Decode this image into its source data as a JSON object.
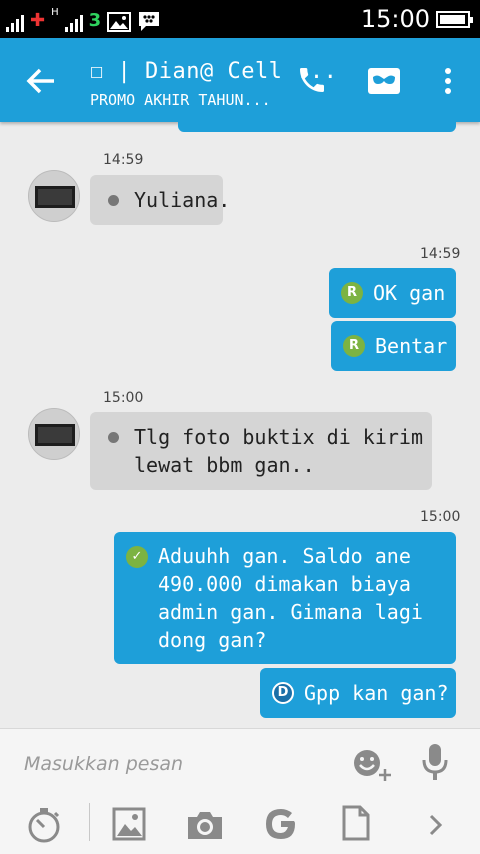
{
  "status_bar": {
    "time": "15:00",
    "network_label": "H",
    "carrier_glyph": "3",
    "battery_level": 0.95
  },
  "header": {
    "title": "☐ | Dian@ Cell ...",
    "subtitle": "PROMO AKHIR TAHUN...",
    "icons": [
      "back-arrow-icon",
      "phone-icon",
      "mask-icon",
      "more-vert-icon"
    ]
  },
  "messages": [
    {
      "time": "14:59",
      "direction": "in",
      "text": "Yuliana.",
      "indicator": "dot"
    },
    {
      "time": "14:59",
      "direction": "out",
      "text": "OK gan",
      "indicator": "R"
    },
    {
      "time": "",
      "direction": "out",
      "text": "Bentar",
      "indicator": "R"
    },
    {
      "time": "15:00",
      "direction": "in",
      "text_lines": [
        "Tlg foto buktix di kirim",
        "lewat bbm gan.."
      ],
      "indicator": "dot"
    },
    {
      "time": "15:00",
      "direction": "out",
      "text_lines": [
        "Aduuhh gan. Saldo ane",
        "490.000 dimakan biaya",
        "admin gan. Gimana lagi",
        "dong gan?"
      ],
      "indicator": "check"
    },
    {
      "time": "",
      "direction": "out",
      "text": "Gpp kan gan?",
      "indicator": "D"
    }
  ],
  "indicators": {
    "read": "R",
    "delivered": "D",
    "check": "✓"
  },
  "composer": {
    "placeholder": "Masukkan pesan",
    "icons": [
      "emoji-add-icon",
      "microphone-icon",
      "timer-icon",
      "gallery-icon",
      "camera-icon",
      "google-icon",
      "file-icon",
      "chevron-right-icon"
    ]
  },
  "colors": {
    "accent": "#1e9fd9",
    "incoming_bubble": "#d5d5d5",
    "read_badge": "#7cb342",
    "background": "#ececec"
  }
}
